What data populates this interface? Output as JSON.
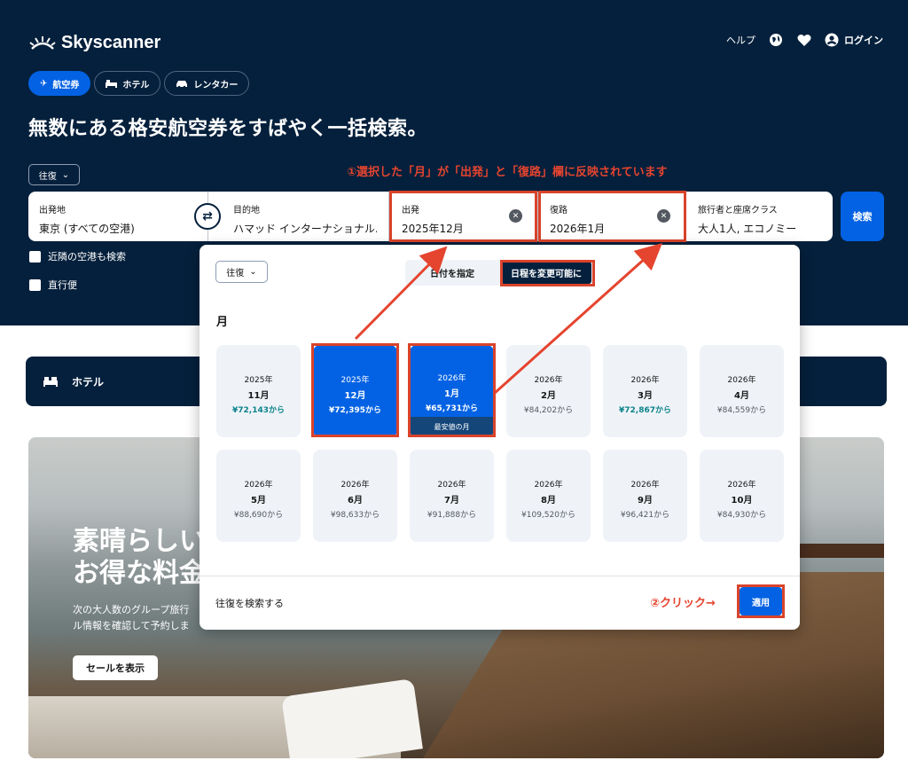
{
  "header": {
    "logo_text": "Skyscanner",
    "help_label": "ヘルプ",
    "login_label": "ログイン"
  },
  "tabs": [
    {
      "label": "航空券",
      "active": true
    },
    {
      "label": "ホテル",
      "active": false
    },
    {
      "label": "レンタカー",
      "active": false
    }
  ],
  "headline": "無数にある格安航空券をすばやく一括検索。",
  "trip_type": "往復",
  "annotation_1": "①選択した「月」が「出発」と「復路」欄に反映されています",
  "search": {
    "origin_label": "出発地",
    "origin_value": "東京 (すべての空港)",
    "destination_label": "目的地",
    "destination_value": "ハマッド インターナショナル...",
    "depart_label": "出発",
    "depart_value": "2025年12月",
    "return_label": "復路",
    "return_value": "2026年1月",
    "travellers_label": "旅行者と座席クラス",
    "travellers_value": "大人1人, エコノミー",
    "search_button": "検索"
  },
  "checkboxes": {
    "nearby": "近隣の空港も検索",
    "direct": "直行便"
  },
  "hotel_bar": {
    "label": "ホテル"
  },
  "banner": {
    "headline_line1": "素晴らしい",
    "headline_line2": "お得な料金",
    "sub_line1": "次の大人数のグループ旅行",
    "sub_line2": "ル情報を確認して予約しま",
    "sale_button": "セールを表示"
  },
  "datepicker": {
    "trip_type": "往復",
    "seg_specific": "日付を指定",
    "seg_flexible": "日程を変更可能に",
    "month_heading": "月",
    "months": [
      {
        "year": "2025年",
        "month": "11月",
        "price": "¥72,143から",
        "cheap": true,
        "selected": false
      },
      {
        "year": "2025年",
        "month": "12月",
        "price": "¥72,395から",
        "cheap": false,
        "selected": true
      },
      {
        "year": "2026年",
        "month": "1月",
        "price": "¥65,731から",
        "cheap": false,
        "selected": true,
        "tag": "最安値の月"
      },
      {
        "year": "2026年",
        "month": "2月",
        "price": "¥84,202から",
        "cheap": false,
        "selected": false
      },
      {
        "year": "2026年",
        "month": "3月",
        "price": "¥72,867から",
        "cheap": true,
        "selected": false
      },
      {
        "year": "2026年",
        "month": "4月",
        "price": "¥84,559から",
        "cheap": false,
        "selected": false
      },
      {
        "year": "2026年",
        "month": "5月",
        "price": "¥88,690から",
        "cheap": false,
        "selected": false
      },
      {
        "year": "2026年",
        "month": "6月",
        "price": "¥98,633から",
        "cheap": false,
        "selected": false
      },
      {
        "year": "2026年",
        "month": "7月",
        "price": "¥91,888から",
        "cheap": false,
        "selected": false
      },
      {
        "year": "2026年",
        "month": "8月",
        "price": "¥109,520から",
        "cheap": false,
        "selected": false
      },
      {
        "year": "2026年",
        "month": "9月",
        "price": "¥96,421から",
        "cheap": false,
        "selected": false
      },
      {
        "year": "2026年",
        "month": "10月",
        "price": "¥84,930から",
        "cheap": false,
        "selected": false
      }
    ],
    "footer_text": "往復を検索する",
    "annotation_2": "②クリック→",
    "apply_button": "適用"
  },
  "colors": {
    "navy": "#05203c",
    "blue": "#0362e3",
    "annotation_red": "#d9432b",
    "cheap_green": "#0c838a"
  }
}
